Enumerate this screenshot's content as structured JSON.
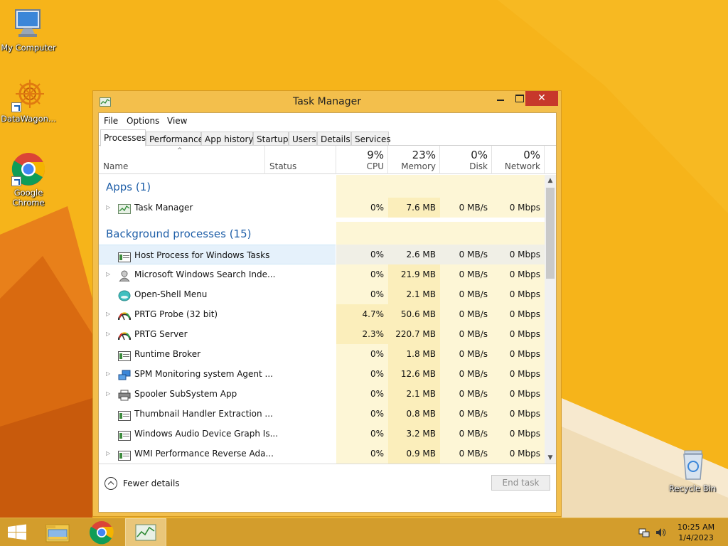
{
  "desktop": {
    "icons": [
      {
        "label": "My Computer",
        "icon": "computer-icon"
      },
      {
        "label": "DataWagon...",
        "icon": "datawagon-icon"
      },
      {
        "label": "Google Chrome",
        "icon": "chrome-icon"
      },
      {
        "label": "Recycle Bin",
        "icon": "recycle-bin-icon"
      }
    ]
  },
  "window": {
    "title": "Task Manager",
    "close_glyph": "✕"
  },
  "menu": {
    "file": "File",
    "options": "Options",
    "view": "View"
  },
  "tabs": [
    {
      "label": "Processes",
      "active": true
    },
    {
      "label": "Performance"
    },
    {
      "label": "App history"
    },
    {
      "label": "Startup"
    },
    {
      "label": "Users"
    },
    {
      "label": "Details"
    },
    {
      "label": "Services"
    }
  ],
  "columns": {
    "name": "Name",
    "status": "Status",
    "cpu": {
      "pct": "9%",
      "label": "CPU"
    },
    "memory": {
      "pct": "23%",
      "label": "Memory"
    },
    "disk": {
      "pct": "0%",
      "label": "Disk"
    },
    "network": {
      "pct": "0%",
      "label": "Network"
    },
    "sort_glyph": "^"
  },
  "groups": {
    "apps": "Apps (1)",
    "background": "Background processes (15)"
  },
  "apps": [
    {
      "name": "Task Manager",
      "cpu": "0%",
      "memory": "7.6 MB",
      "disk": "0 MB/s",
      "network": "0 Mbps",
      "expandable": true,
      "icon": "task-manager-icon"
    }
  ],
  "processes": [
    {
      "name": "Host Process for Windows Tasks",
      "cpu": "0%",
      "memory": "2.6 MB",
      "disk": "0 MB/s",
      "network": "0 Mbps",
      "expandable": false,
      "icon": "window-app-icon",
      "selected": true
    },
    {
      "name": "Microsoft Windows Search Inde...",
      "cpu": "0%",
      "memory": "21.9 MB",
      "disk": "0 MB/s",
      "network": "0 Mbps",
      "expandable": true,
      "icon": "search-indexer-icon"
    },
    {
      "name": "Open-Shell Menu",
      "cpu": "0%",
      "memory": "2.1 MB",
      "disk": "0 MB/s",
      "network": "0 Mbps",
      "expandable": false,
      "icon": "open-shell-icon"
    },
    {
      "name": "PRTG Probe (32 bit)",
      "cpu": "4.7%",
      "memory": "50.6 MB",
      "disk": "0 MB/s",
      "network": "0 Mbps",
      "expandable": true,
      "icon": "gauge-icon"
    },
    {
      "name": "PRTG Server",
      "cpu": "2.3%",
      "memory": "220.7 MB",
      "disk": "0 MB/s",
      "network": "0 Mbps",
      "expandable": true,
      "icon": "gauge-icon"
    },
    {
      "name": "Runtime Broker",
      "cpu": "0%",
      "memory": "1.8 MB",
      "disk": "0 MB/s",
      "network": "0 Mbps",
      "expandable": false,
      "icon": "window-app-icon"
    },
    {
      "name": "SPM Monitoring system Agent ...",
      "cpu": "0%",
      "memory": "12.6 MB",
      "disk": "0 MB/s",
      "network": "0 Mbps",
      "expandable": true,
      "icon": "network-monitor-icon"
    },
    {
      "name": "Spooler SubSystem App",
      "cpu": "0%",
      "memory": "2.1 MB",
      "disk": "0 MB/s",
      "network": "0 Mbps",
      "expandable": true,
      "icon": "printer-icon"
    },
    {
      "name": "Thumbnail Handler Extraction ...",
      "cpu": "0%",
      "memory": "0.8 MB",
      "disk": "0 MB/s",
      "network": "0 Mbps",
      "expandable": false,
      "icon": "window-app-icon"
    },
    {
      "name": "Windows Audio Device Graph Is...",
      "cpu": "0%",
      "memory": "3.2 MB",
      "disk": "0 MB/s",
      "network": "0 Mbps",
      "expandable": false,
      "icon": "window-app-icon"
    },
    {
      "name": "WMI Performance Reverse Ada...",
      "cpu": "0%",
      "memory": "0.9 MB",
      "disk": "0 MB/s",
      "network": "0 Mbps",
      "expandable": true,
      "icon": "window-app-icon"
    }
  ],
  "footer": {
    "fewer_details": "Fewer details",
    "end_task": "End task"
  },
  "taskbar": {
    "time": "10:25 AM",
    "date": "1/4/2023"
  },
  "colors": {
    "group_title": "#1f5fa8",
    "close_button": "#c7382b",
    "desktop_bg": "#f6b41a",
    "taskbar": "#d39d2c"
  }
}
